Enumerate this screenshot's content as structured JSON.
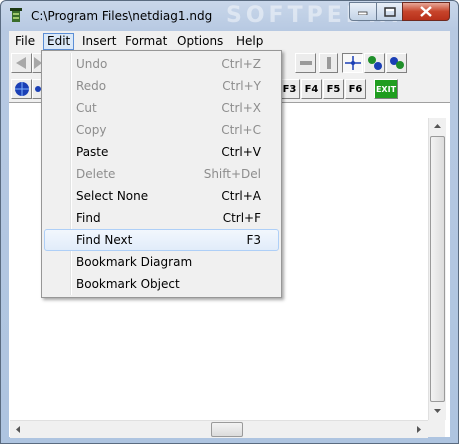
{
  "window": {
    "title": "C:\\Program Files\\netdiag1.ndg",
    "watermark": "SOFTPEDIA"
  },
  "menubar": {
    "items": [
      "File",
      "Edit",
      "Insert",
      "Format",
      "Options",
      "Help"
    ]
  },
  "toolbar": {
    "function_keys": [
      "F3",
      "F4",
      "F5",
      "F6"
    ],
    "exit_label": "EXIT"
  },
  "edit_menu": {
    "items": [
      {
        "label": "Undo",
        "shortcut": "Ctrl+Z",
        "enabled": false
      },
      {
        "label": "Redo",
        "shortcut": "Ctrl+Y",
        "enabled": false
      },
      {
        "label": "Cut",
        "shortcut": "Ctrl+X",
        "enabled": false
      },
      {
        "label": "Copy",
        "shortcut": "Ctrl+C",
        "enabled": false
      },
      {
        "label": "Paste",
        "shortcut": "Ctrl+V",
        "enabled": true
      },
      {
        "label": "Delete",
        "shortcut": "Shift+Del",
        "enabled": false
      },
      {
        "label": "Select None",
        "shortcut": "Ctrl+A",
        "enabled": true
      },
      {
        "label": "Find",
        "shortcut": "Ctrl+F",
        "enabled": true
      },
      {
        "label": "Find Next",
        "shortcut": "F3",
        "enabled": true,
        "highlighted": true
      },
      {
        "label": "Bookmark Diagram",
        "shortcut": "",
        "enabled": true
      },
      {
        "label": "Bookmark Object",
        "shortcut": "",
        "enabled": true
      }
    ]
  },
  "colors": {
    "menu_highlight_border": "#aecff7",
    "close_button": "#c7442b",
    "exit_button": "#1f9d1f"
  }
}
